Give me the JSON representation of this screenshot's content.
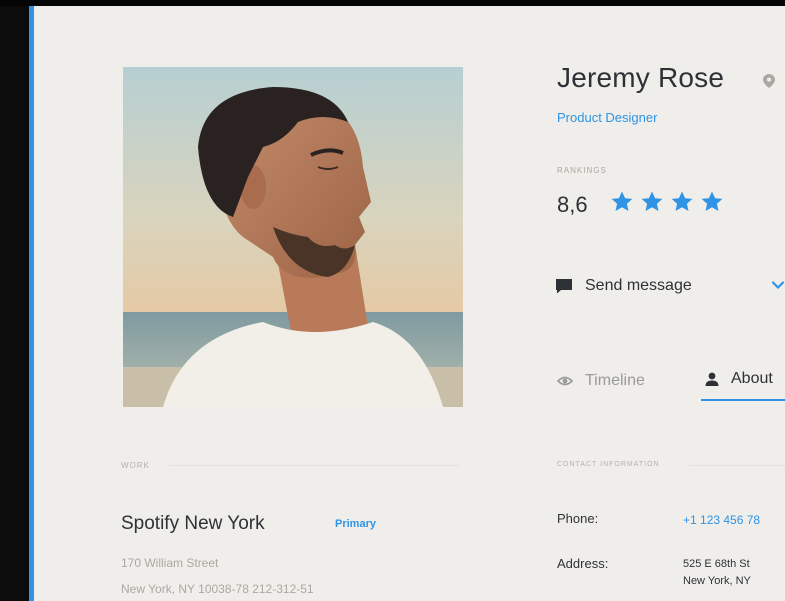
{
  "profile": {
    "name": "Jeremy Rose",
    "title": "Product Designer",
    "rankings_label": "RANKINGS",
    "ranking_value": "8,6",
    "stars_filled": 4,
    "send_message_label": "Send message"
  },
  "tabs": {
    "timeline": "Timeline",
    "about": "About"
  },
  "work": {
    "section_label": "WORK",
    "company": "Spotify New York",
    "badge": "Primary",
    "address_line1": "170 William Street",
    "address_line2": "New York, NY 10038-78 212-312-51"
  },
  "contact": {
    "section_label": "CONTACT INFORMATION",
    "phone_label": "Phone:",
    "phone_value": "+1 123 456 78",
    "address_label": "Address:",
    "address_line1": "525 E 68th St",
    "address_line2": "New York, NY"
  },
  "colors": {
    "accent": "#2f93e6",
    "background": "#efeeea",
    "text": "#2e3136"
  },
  "icons": {
    "location": "location-pin-icon",
    "star": "star-icon",
    "message": "chat-bubble-icon",
    "more": "chevron-down-icon",
    "timeline": "eye-icon",
    "about": "user-icon"
  }
}
